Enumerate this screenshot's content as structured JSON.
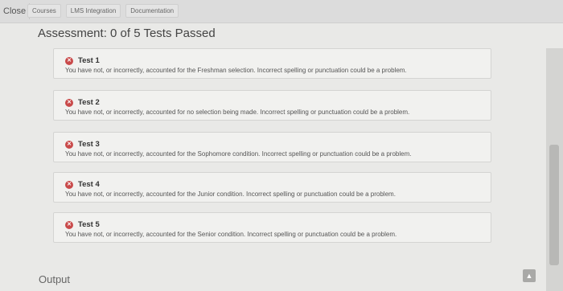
{
  "topbar": {
    "close_label": "Close",
    "nav": [
      "Courses",
      "LMS Integration",
      "Documentation"
    ]
  },
  "assessment": {
    "title": "Assessment: 0 of 5 Tests Passed"
  },
  "tests": [
    {
      "title": "Test 1",
      "message": "You have not, or incorrectly, accounted for the Freshman selection. Incorrect spelling or punctuation could be a problem."
    },
    {
      "title": "Test 2",
      "message": "You have not, or incorrectly, accounted for no selection being made. Incorrect spelling or punctuation could be a problem."
    },
    {
      "title": "Test 3",
      "message": "You have not, or incorrectly, accounted for the Sophomore condition. Incorrect spelling or punctuation could be a problem."
    },
    {
      "title": "Test 4",
      "message": "You have not, or incorrectly, accounted for the Junior condition. Incorrect spelling or punctuation could be a problem."
    },
    {
      "title": "Test 5",
      "message": "You have not, or incorrectly, accounted for the Senior condition. Incorrect spelling or punctuation could be a problem."
    }
  ],
  "output": {
    "label": "Output"
  },
  "icons": {
    "fail": "x-circle-icon",
    "scroll_up": "chevron-up-icon"
  },
  "colors": {
    "fail_icon": "#c94a4a"
  }
}
